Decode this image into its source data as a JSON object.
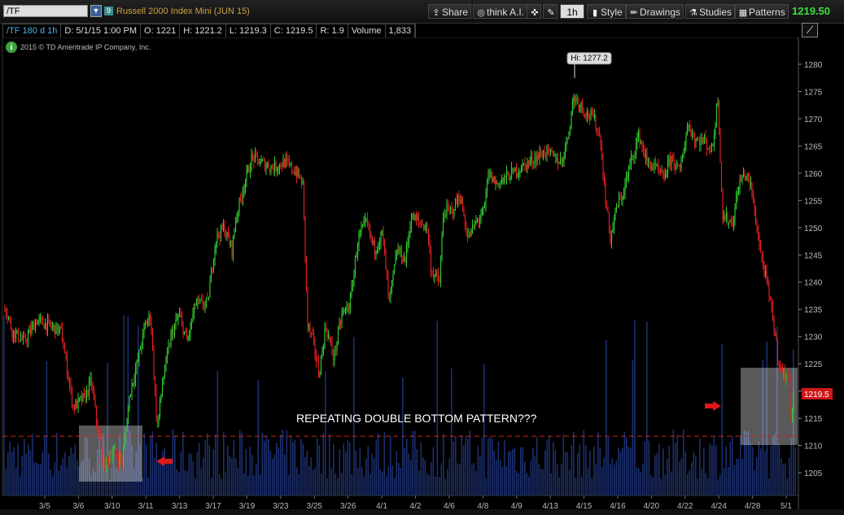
{
  "toolbar": {
    "symbol": "/TF",
    "link_badge": "9",
    "instrument": "Russell 2000 Index Mini (JUN 15)",
    "share": "Share",
    "think": "think A.I.",
    "aggregation": "1h",
    "style": "Style",
    "drawings": "Drawings",
    "studies": "Studies",
    "patterns": "Patterns",
    "last_price": "1219.50"
  },
  "info": {
    "symbol": "/TF 180 d 1h",
    "date": "D: 5/1/15 1:00 PM",
    "open": "O: 1221",
    "high": "H: 1221.2",
    "low": "L: 1219.3",
    "close": "C: 1219.5",
    "range": "R: 1.9",
    "volume_label": "Volume",
    "volume_value": "1,833"
  },
  "copyright": "2015 © TD Ameritrade IP Company, Inc.",
  "annotation": "REPEATING DOUBLE BOTTOM PATTERN???",
  "colors": {
    "up": "#2ecc2e",
    "down": "#e02020",
    "volume": "#1c2f6e",
    "level": "#d02020"
  },
  "chart_data": {
    "type": "candlestick",
    "y_axis_ticks": [
      "1280",
      "1275",
      "1270",
      "1265",
      "1260",
      "1255",
      "1250",
      "1245",
      "1240",
      "1235",
      "1230",
      "1225",
      "1220",
      "1215",
      "1210",
      "1205"
    ],
    "ylim": [
      1201,
      1284
    ],
    "x_labels": [
      "3/5",
      "3/6",
      "3/10",
      "3/11",
      "3/13",
      "3/17",
      "3/19",
      "3/23",
      "3/25",
      "3/26",
      "4/1",
      "4/2",
      "4/6",
      "4/8",
      "4/9",
      "4/13",
      "4/15",
      "4/16",
      "4/20",
      "4/22",
      "4/24",
      "4/28",
      "5/1"
    ],
    "high_bubble": "Hi: 1277.2",
    "high_value": 1277.2,
    "last_bubble": "1219.5",
    "last_value": 1219.5,
    "support_level": 1211.7,
    "path": [
      [
        0,
        1239
      ],
      [
        15,
        1231
      ],
      [
        30,
        1229
      ],
      [
        45,
        1233
      ],
      [
        60,
        1232
      ],
      [
        75,
        1231
      ],
      [
        90,
        1217
      ],
      [
        105,
        1219
      ],
      [
        112,
        1222
      ],
      [
        120,
        1213
      ],
      [
        128,
        1206
      ],
      [
        138,
        1209
      ],
      [
        150,
        1207
      ],
      [
        160,
        1220
      ],
      [
        170,
        1226
      ],
      [
        178,
        1232
      ],
      [
        185,
        1234
      ],
      [
        193,
        1213
      ],
      [
        200,
        1222
      ],
      [
        210,
        1230
      ],
      [
        220,
        1234
      ],
      [
        230,
        1229
      ],
      [
        240,
        1236
      ],
      [
        255,
        1236
      ],
      [
        265,
        1248
      ],
      [
        275,
        1250
      ],
      [
        285,
        1246
      ],
      [
        290,
        1252
      ],
      [
        300,
        1258
      ],
      [
        310,
        1263
      ],
      [
        320,
        1262
      ],
      [
        335,
        1261
      ],
      [
        350,
        1262
      ],
      [
        365,
        1260
      ],
      [
        372,
        1258
      ],
      [
        378,
        1232
      ],
      [
        385,
        1229
      ],
      [
        392,
        1223
      ],
      [
        400,
        1232
      ],
      [
        410,
        1226
      ],
      [
        420,
        1234
      ],
      [
        430,
        1236
      ],
      [
        440,
        1248
      ],
      [
        450,
        1251
      ],
      [
        460,
        1246
      ],
      [
        470,
        1249
      ],
      [
        478,
        1236
      ],
      [
        488,
        1246
      ],
      [
        498,
        1244
      ],
      [
        505,
        1252
      ],
      [
        515,
        1251
      ],
      [
        525,
        1250
      ],
      [
        530,
        1242
      ],
      [
        540,
        1240
      ],
      [
        545,
        1253
      ],
      [
        555,
        1253
      ],
      [
        565,
        1256
      ],
      [
        575,
        1248
      ],
      [
        585,
        1251
      ],
      [
        595,
        1253
      ],
      [
        600,
        1260
      ],
      [
        610,
        1258
      ],
      [
        620,
        1259
      ],
      [
        630,
        1260
      ],
      [
        640,
        1261
      ],
      [
        650,
        1262
      ],
      [
        660,
        1263
      ],
      [
        670,
        1264
      ],
      [
        680,
        1263
      ],
      [
        690,
        1262
      ],
      [
        698,
        1267
      ],
      [
        705,
        1274
      ],
      [
        712,
        1273
      ],
      [
        720,
        1271
      ],
      [
        730,
        1270
      ],
      [
        738,
        1266
      ],
      [
        742,
        1258
      ],
      [
        750,
        1248
      ],
      [
        758,
        1254
      ],
      [
        765,
        1256
      ],
      [
        775,
        1262
      ],
      [
        785,
        1267
      ],
      [
        795,
        1262
      ],
      [
        805,
        1261
      ],
      [
        815,
        1259
      ],
      [
        825,
        1263
      ],
      [
        835,
        1260
      ],
      [
        845,
        1269
      ],
      [
        855,
        1266
      ],
      [
        865,
        1266
      ],
      [
        875,
        1264
      ],
      [
        882,
        1274
      ],
      [
        888,
        1252
      ],
      [
        900,
        1251
      ],
      [
        908,
        1258
      ],
      [
        915,
        1260
      ],
      [
        922,
        1258
      ],
      [
        928,
        1252
      ],
      [
        935,
        1245
      ],
      [
        942,
        1240
      ],
      [
        950,
        1233
      ],
      [
        956,
        1226
      ],
      [
        962,
        1223
      ],
      [
        968,
        1223
      ],
      [
        972,
        1216
      ],
      [
        976,
        1219.5
      ]
    ]
  }
}
